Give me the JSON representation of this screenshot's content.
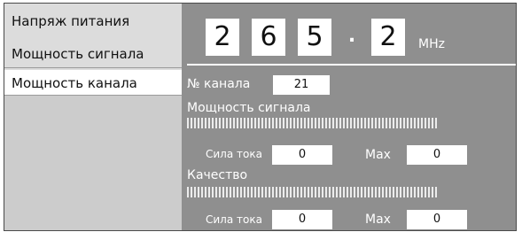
{
  "menu": {
    "items": [
      {
        "label": "Напряж питания"
      },
      {
        "label": "Мощность сигнала"
      },
      {
        "label": "Мощность канала",
        "selected": true
      }
    ]
  },
  "frequency": {
    "digits": [
      "2",
      "6",
      "5",
      "2"
    ],
    "separator": ".",
    "unit": "MHz"
  },
  "channel": {
    "label": "№ канала",
    "value": "21"
  },
  "signal_power": {
    "label": "Мощность сигнала",
    "current_label": "Сила тока",
    "current_value": "0",
    "max_label": "Max",
    "max_value": "0",
    "level": 0
  },
  "quality": {
    "label": "Качество",
    "current_label": "Сила тока",
    "current_value": "0",
    "max_label": "Max",
    "max_value": "0",
    "level": 0
  },
  "colors": {
    "panel_background": "#8f8f8f",
    "menu_background": "#dcdcdc",
    "selected_item_background": "#ffffff",
    "text_light": "#ffffff"
  }
}
